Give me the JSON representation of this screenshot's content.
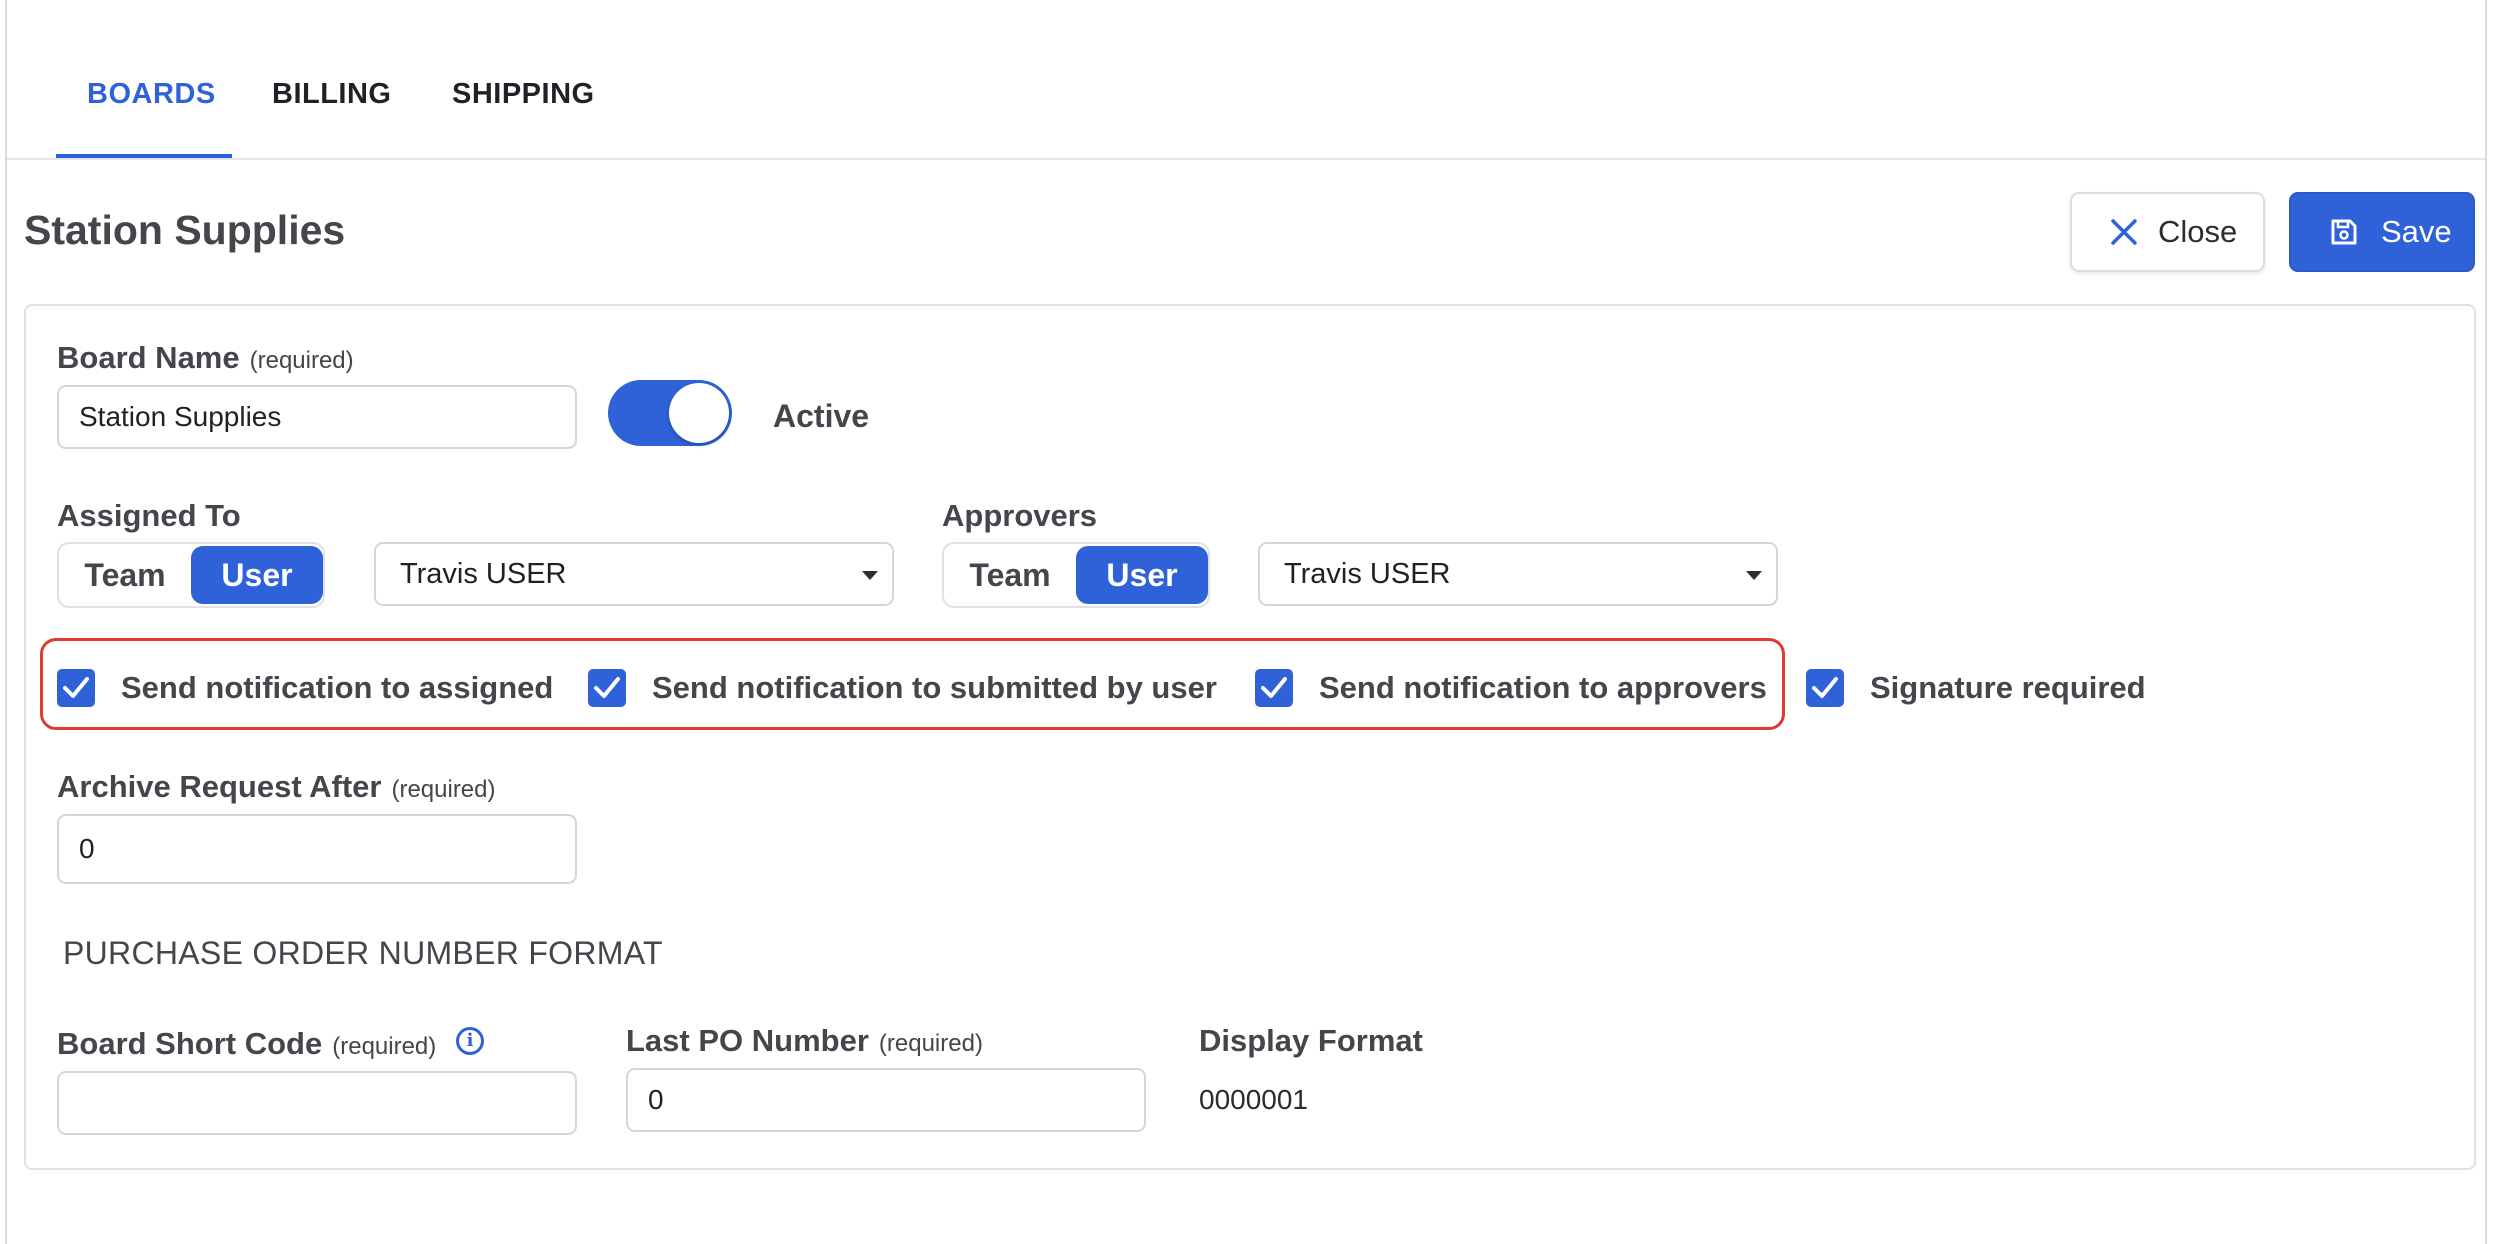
{
  "tabs": [
    {
      "label": "BOARDS",
      "active": true
    },
    {
      "label": "BILLING",
      "active": false
    },
    {
      "label": "SHIPPING",
      "active": false
    }
  ],
  "header": {
    "title": "Station Supplies",
    "close_label": "Close",
    "save_label": "Save"
  },
  "form": {
    "board_name": {
      "label": "Board Name",
      "required": "(required)",
      "value": "Station Supplies"
    },
    "active": {
      "label": "Active",
      "on": true
    },
    "assigned_to": {
      "label": "Assigned To",
      "options": [
        "Team",
        "User"
      ],
      "selected": "User",
      "select_value": "Travis USER"
    },
    "approvers": {
      "label": "Approvers",
      "options": [
        "Team",
        "User"
      ],
      "selected": "User",
      "select_value": "Travis USER"
    },
    "checkboxes": [
      {
        "label": "Send notification to assigned",
        "checked": true
      },
      {
        "label": "Send notification to submitted by user",
        "checked": true
      },
      {
        "label": "Send notification to approvers",
        "checked": true
      },
      {
        "label": "Signature required",
        "checked": true
      }
    ],
    "archive": {
      "label": "Archive Request After",
      "required": "(required)",
      "value": "0"
    },
    "po_section": "PURCHASE ORDER NUMBER FORMAT",
    "short_code": {
      "label": "Board Short Code",
      "required": "(required)",
      "value": ""
    },
    "last_po": {
      "label": "Last PO Number",
      "required": "(required)",
      "value": "0"
    },
    "display_format": {
      "label": "Display Format",
      "value": "0000001"
    }
  },
  "colors": {
    "accent": "#2f62d9",
    "highlight": "#e03a2e"
  },
  "icons": {
    "close": "close-icon",
    "save": "save-icon",
    "info": "info-icon",
    "check": "check-icon",
    "caret": "caret-down-icon"
  }
}
